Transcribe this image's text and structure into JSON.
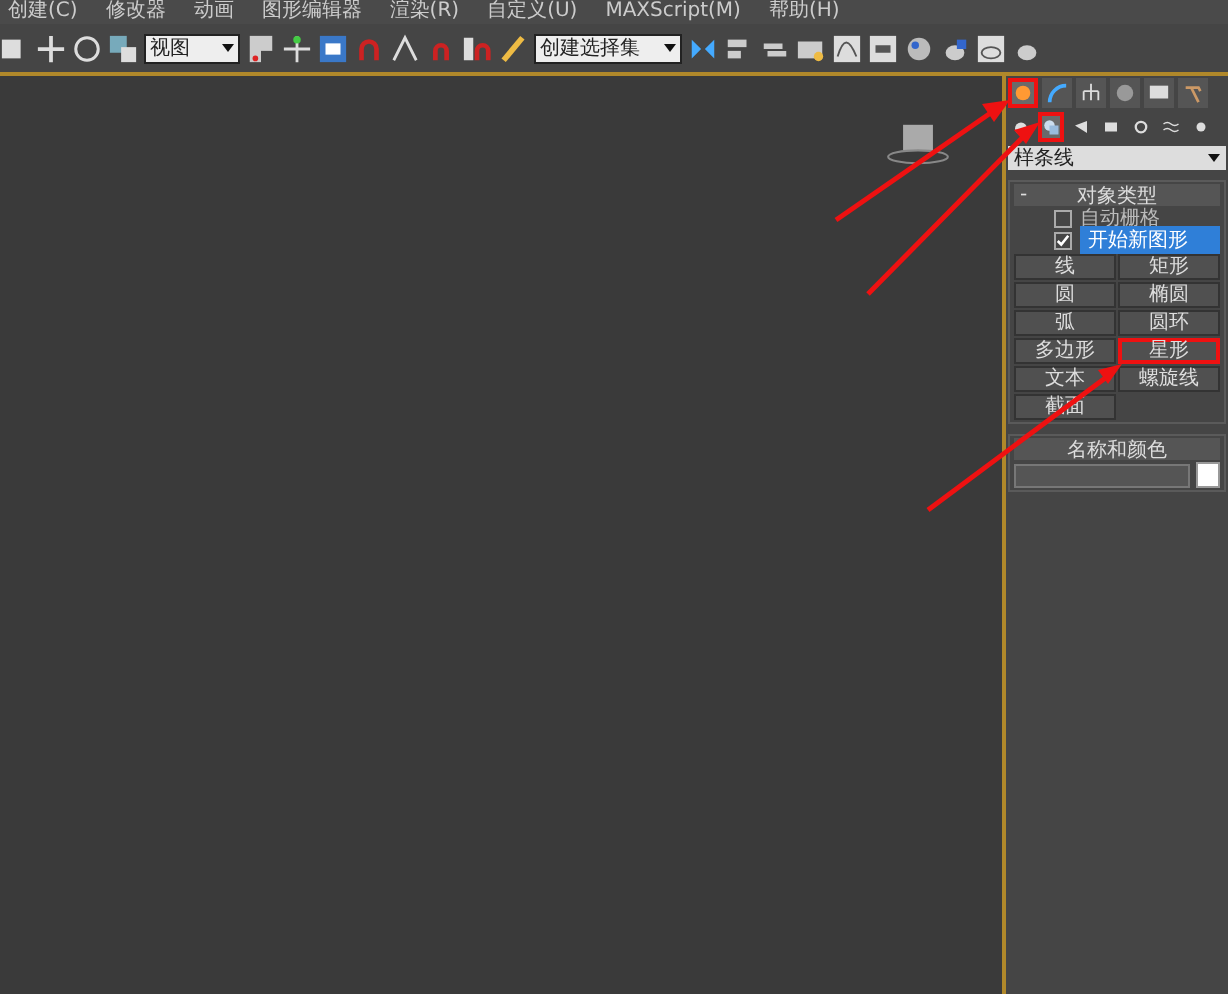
{
  "menu_bar": [
    "创建(C)",
    "修改器",
    "动画",
    "图形编辑器",
    "渲染(R)",
    "自定义(U)",
    "MAXScript(M)",
    "帮助(H)"
  ],
  "toolbar": {
    "view_dropdown": "视图",
    "selection_set_dropdown": "创建选择集"
  },
  "command_tabs": [
    {
      "selected": true,
      "highlighted": true
    },
    {
      "selected": false,
      "highlighted": false
    },
    {
      "selected": false,
      "highlighted": false
    },
    {
      "selected": false,
      "highlighted": false
    },
    {
      "selected": false,
      "highlighted": false
    },
    {
      "selected": false,
      "highlighted": false
    }
  ],
  "category_tabs": [
    {
      "selected": false,
      "highlighted": false
    },
    {
      "selected": true,
      "highlighted": true
    },
    {
      "selected": false,
      "highlighted": false
    },
    {
      "selected": false,
      "highlighted": false
    },
    {
      "selected": false,
      "highlighted": false
    },
    {
      "selected": false,
      "highlighted": false
    },
    {
      "selected": false,
      "highlighted": false
    }
  ],
  "category_dropdown": "样条线",
  "object_type": {
    "collapse_sign": "-",
    "title": "对象类型",
    "options": [
      {
        "label": "自动栅格",
        "checked": false
      },
      {
        "label": "开始新图形",
        "checked": true
      }
    ],
    "buttons": [
      {
        "label": "线",
        "highlighted": false
      },
      {
        "label": "矩形",
        "highlighted": false
      },
      {
        "label": "圆",
        "highlighted": false
      },
      {
        "label": "椭圆",
        "highlighted": false
      },
      {
        "label": "弧",
        "highlighted": false
      },
      {
        "label": "圆环",
        "highlighted": false
      },
      {
        "label": "多边形",
        "highlighted": false
      },
      {
        "label": "星形",
        "highlighted": true
      },
      {
        "label": "文本",
        "highlighted": false
      },
      {
        "label": "螺旋线",
        "highlighted": false
      },
      {
        "label": "截面",
        "highlighted": false
      }
    ]
  },
  "name_and_color": {
    "title": "名称和颜色",
    "color": "#ffffff"
  }
}
